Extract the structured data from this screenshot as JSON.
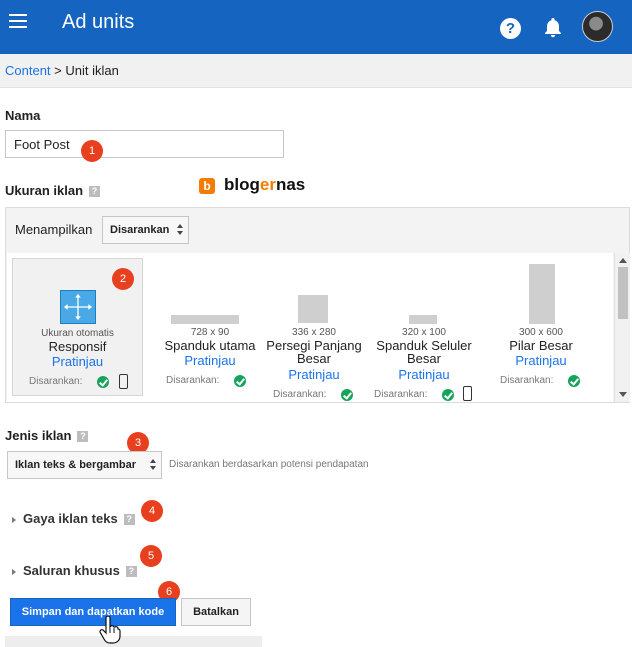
{
  "header": {
    "title": "Ad units",
    "help_glyph": "?",
    "colors": {
      "bar": "#1565c0",
      "text": "#ffffff"
    }
  },
  "breadcrumb": {
    "link": "Content",
    "separator": ">",
    "current": "Unit iklan"
  },
  "name_section": {
    "label": "Nama",
    "value": "Foot Post"
  },
  "size_section": {
    "label": "Ukuran iklan",
    "help_glyph": "?",
    "show_label": "Menampilkan",
    "filter_value": "Disarankan",
    "units": [
      {
        "dimension": "Ukuran otomatis",
        "name": "Responsif",
        "preview": "Pratinjau",
        "recommended": "Disarankan:",
        "mobile": true,
        "selected": true
      },
      {
        "dimension": "728 x 90",
        "name": "Spanduk utama",
        "preview": "Pratinjau",
        "recommended": "Disarankan:",
        "mobile": false,
        "selected": false
      },
      {
        "dimension": "336 x 280",
        "name": "Persegi Panjang Besar",
        "preview": "Pratinjau",
        "recommended": "Disarankan:",
        "mobile": false,
        "selected": false
      },
      {
        "dimension": "320 x 100",
        "name": "Spanduk Seluler Besar",
        "preview": "Pratinjau",
        "recommended": "Disarankan:",
        "mobile": true,
        "selected": false
      },
      {
        "dimension": "300 x 600",
        "name": "Pilar Besar",
        "preview": "Pratinjau",
        "recommended": "Disarankan:",
        "mobile": false,
        "selected": false
      }
    ]
  },
  "watermark": {
    "icon_letter": "b",
    "text_dark": "blog",
    "text_accent": "er",
    "text_dark2": "nas"
  },
  "ad_type_section": {
    "label": "Jenis iklan",
    "help_glyph": "?",
    "value": "Iklan teks & bergambar",
    "hint": "Disarankan berdasarkan potensi pendapatan"
  },
  "text_style_section": {
    "label": "Gaya iklan teks",
    "help_glyph": "?"
  },
  "custom_channels_section": {
    "label": "Saluran khusus",
    "help_glyph": "?"
  },
  "actions": {
    "save_label": "Simpan dan dapatkan kode",
    "cancel_label": "Batalkan"
  },
  "steps": [
    "1",
    "2",
    "3",
    "4",
    "5",
    "6"
  ],
  "colors": {
    "link": "#1a73e8",
    "step_marker": "#e8401f",
    "ok": "#17a35b"
  }
}
